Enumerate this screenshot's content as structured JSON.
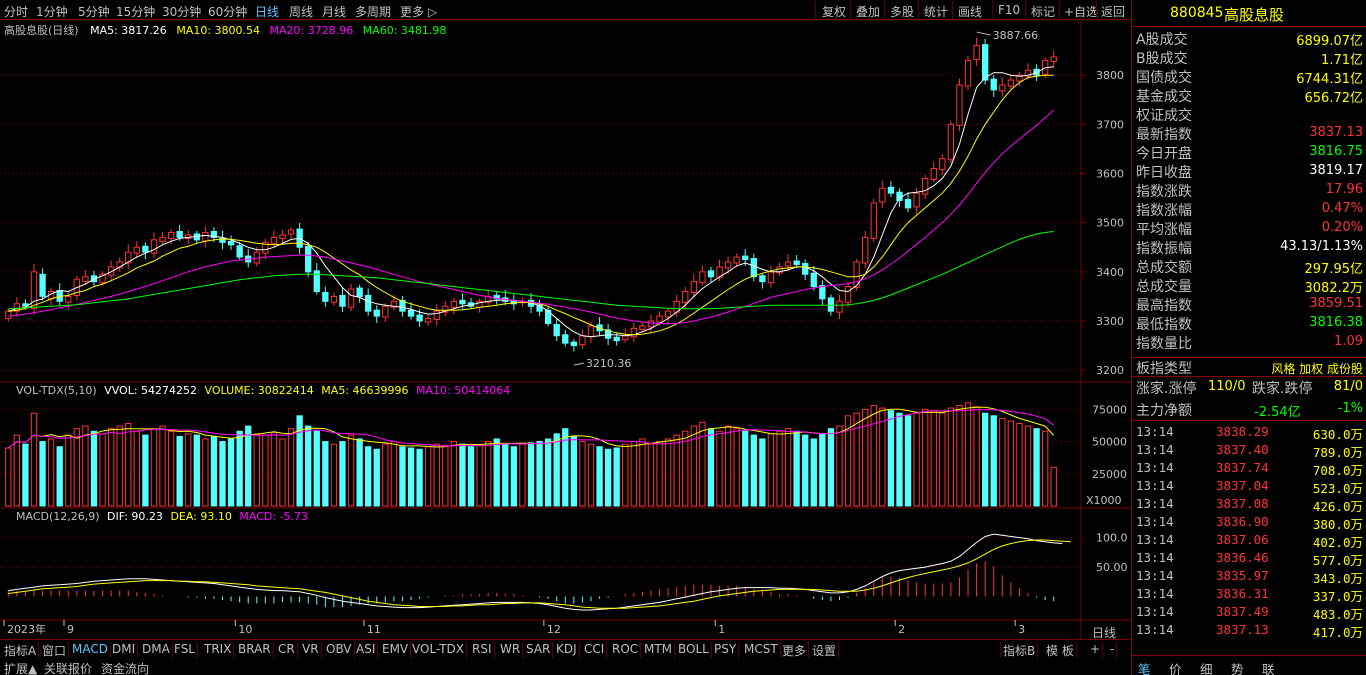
{
  "toolbar": {
    "timeframes": [
      "分时",
      "1分钟",
      "5分钟",
      "15分钟",
      "30分钟",
      "60分钟",
      "日线",
      "周线",
      "月线",
      "多周期",
      "更多 ▷"
    ],
    "active_timeframe": "日线",
    "right_buttons": [
      "复权",
      "叠加",
      "多股",
      "统计",
      "画线",
      "F10",
      "标记",
      "+自选",
      "返回"
    ]
  },
  "main_info": {
    "name": "高股息股(日线)",
    "ma5": "MA5: 3817.26",
    "ma10": "MA10: 3800.54",
    "ma20": "MA20: 3728.96",
    "ma60": "MA60: 3481.98"
  },
  "vol_info": {
    "name": "VOL-TDX(5,10)",
    "vvol": "VVOL: 54274252",
    "volume": "VOLUME: 30822414",
    "ma5": "MA5: 46639996",
    "ma10": "MA10: 50414064"
  },
  "macd_info": {
    "name": "MACD(12,26,9)",
    "dif": "DIF: 90.23",
    "dea": "DEA: 93.10",
    "macd": "MACD: -5.73"
  },
  "colors": {
    "up": "#ff3232",
    "down": "#54ffff",
    "ma5": "#ffffff",
    "ma10": "#ffff00",
    "ma20": "#ff00ff",
    "ma60": "#00ff00",
    "grid": "#7a0000"
  },
  "chart_data": {
    "type": "candlestick",
    "price_axis": {
      "ticks": [
        3200,
        3300,
        3400,
        3500,
        3600,
        3700,
        3800
      ],
      "range": [
        3180,
        3900
      ]
    },
    "volume_axis": {
      "ticks": [
        "25000",
        "50000",
        "75000"
      ],
      "unit": "X1000",
      "range": [
        0,
        90000
      ]
    },
    "macd_axis": {
      "ticks": [
        "50.00",
        "100.0"
      ],
      "range": [
        -40,
        130
      ]
    },
    "high_label": "3887.66",
    "low_label": "3210.36",
    "month_labels": [
      {
        "label": "2023年",
        "index": 0
      },
      {
        "label": "9",
        "index": 7
      },
      {
        "label": "10",
        "index": 27
      },
      {
        "label": "11",
        "index": 42
      },
      {
        "label": "12",
        "index": 63
      },
      {
        "label": "1",
        "index": 83
      },
      {
        "label": "2",
        "index": 104
      },
      {
        "label": "3",
        "index": 118
      }
    ],
    "closes": [
      3320,
      3335,
      3330,
      3400,
      3350,
      3360,
      3340,
      3350,
      3385,
      3390,
      3380,
      3395,
      3410,
      3420,
      3440,
      3450,
      3440,
      3465,
      3470,
      3480,
      3470,
      3475,
      3465,
      3480,
      3470,
      3460,
      3455,
      3430,
      3420,
      3440,
      3460,
      3470,
      3475,
      3485,
      3450,
      3400,
      3360,
      3340,
      3350,
      3330,
      3365,
      3350,
      3320,
      3310,
      3330,
      3340,
      3320,
      3310,
      3300,
      3305,
      3320,
      3330,
      3340,
      3335,
      3330,
      3340,
      3350,
      3345,
      3340,
      3335,
      3340,
      3330,
      3320,
      3295,
      3270,
      3255,
      3250,
      3270,
      3290,
      3280,
      3265,
      3260,
      3270,
      3285,
      3290,
      3300,
      3310,
      3320,
      3340,
      3360,
      3380,
      3400,
      3390,
      3410,
      3420,
      3430,
      3425,
      3390,
      3380,
      3400,
      3410,
      3420,
      3415,
      3395,
      3370,
      3345,
      3320,
      3340,
      3370,
      3420,
      3470,
      3540,
      3570,
      3560,
      3545,
      3530,
      3560,
      3590,
      3610,
      3630,
      3700,
      3780,
      3830,
      3860,
      3790,
      3770,
      3780,
      3790,
      3800,
      3810,
      3800,
      3830,
      3837
    ],
    "opens": [
      3305,
      3320,
      3335,
      3325,
      3395,
      3345,
      3362,
      3338,
      3352,
      3380,
      3392,
      3378,
      3393,
      3408,
      3418,
      3438,
      3452,
      3438,
      3462,
      3468,
      3482,
      3468,
      3477,
      3463,
      3482,
      3468,
      3462,
      3453,
      3432,
      3418,
      3438,
      3458,
      3468,
      3477,
      3487,
      3452,
      3402,
      3358,
      3338,
      3352,
      3328,
      3367,
      3352,
      3322,
      3308,
      3328,
      3342,
      3322,
      3312,
      3298,
      3303,
      3318,
      3328,
      3342,
      3337,
      3328,
      3338,
      3352,
      3347,
      3342,
      3337,
      3342,
      3332,
      3322,
      3293,
      3272,
      3257,
      3252,
      3268,
      3292,
      3282,
      3267,
      3262,
      3268,
      3283,
      3288,
      3298,
      3308,
      3318,
      3338,
      3358,
      3378,
      3402,
      3388,
      3408,
      3418,
      3432,
      3427,
      3392,
      3378,
      3398,
      3412,
      3422,
      3417,
      3397,
      3372,
      3347,
      3318,
      3338,
      3368,
      3418,
      3468,
      3542,
      3572,
      3562,
      3547,
      3532,
      3558,
      3588,
      3608,
      3628,
      3698,
      3778,
      3832,
      3862,
      3792,
      3768,
      3778,
      3788,
      3798,
      3812,
      3802,
      3828
    ],
    "volumes": [
      45,
      55,
      48,
      72,
      50,
      52,
      46,
      55,
      60,
      62,
      58,
      56,
      60,
      62,
      64,
      58,
      55,
      60,
      62,
      58,
      54,
      56,
      55,
      52,
      54,
      50,
      52,
      58,
      62,
      56,
      55,
      57,
      52,
      60,
      70,
      62,
      58,
      50,
      48,
      50,
      55,
      52,
      46,
      44,
      48,
      50,
      46,
      45,
      44,
      46,
      48,
      47,
      50,
      48,
      46,
      47,
      50,
      52,
      48,
      46,
      48,
      49,
      50,
      52,
      56,
      60,
      54,
      50,
      48,
      46,
      44,
      45,
      48,
      50,
      52,
      48,
      50,
      52,
      55,
      58,
      62,
      65,
      60,
      58,
      62,
      60,
      58,
      55,
      52,
      56,
      58,
      60,
      58,
      55,
      52,
      56,
      60,
      62,
      70,
      72,
      75,
      78,
      76,
      74,
      72,
      70,
      72,
      75,
      74,
      72,
      76,
      78,
      80,
      77,
      72,
      70,
      68,
      66,
      64,
      62,
      60,
      58,
      30
    ],
    "ma5": [
      3320,
      3325,
      3328,
      3340,
      3345,
      3355,
      3362,
      3360,
      3368,
      3375,
      3385,
      3392,
      3400,
      3410,
      3420,
      3430,
      3438,
      3445,
      3455,
      3462,
      3468,
      3470,
      3472,
      3474,
      3472,
      3470,
      3465,
      3458,
      3450,
      3445,
      3445,
      3450,
      3458,
      3466,
      3468,
      3458,
      3438,
      3412,
      3390,
      3368,
      3352,
      3348,
      3340,
      3335,
      3332,
      3330,
      3328,
      3324,
      3318,
      3314,
      3315,
      3320,
      3325,
      3330,
      3333,
      3337,
      3340,
      3342,
      3343,
      3342,
      3340,
      3336,
      3332,
      3320,
      3305,
      3290,
      3278,
      3270,
      3268,
      3270,
      3272,
      3272,
      3270,
      3272,
      3278,
      3285,
      3295,
      3305,
      3318,
      3332,
      3350,
      3366,
      3378,
      3390,
      3400,
      3412,
      3418,
      3412,
      3405,
      3400,
      3400,
      3404,
      3410,
      3410,
      3402,
      3390,
      3375,
      3362,
      3360,
      3372,
      3395,
      3430,
      3475,
      3520,
      3550,
      3560,
      3562,
      3565,
      3575,
      3590,
      3615,
      3660,
      3720,
      3775,
      3795,
      3805,
      3805,
      3800,
      3798,
      3800,
      3805,
      3815,
      3817
    ],
    "ma10": [
      3320,
      3322,
      3325,
      3332,
      3338,
      3345,
      3350,
      3352,
      3358,
      3362,
      3370,
      3375,
      3382,
      3390,
      3398,
      3408,
      3415,
      3422,
      3432,
      3440,
      3448,
      3452,
      3458,
      3462,
      3465,
      3467,
      3466,
      3464,
      3461,
      3458,
      3456,
      3455,
      3456,
      3458,
      3458,
      3455,
      3450,
      3440,
      3428,
      3416,
      3404,
      3394,
      3380,
      3368,
      3358,
      3348,
      3340,
      3335,
      3330,
      3325,
      3322,
      3322,
      3322,
      3323,
      3325,
      3328,
      3330,
      3332,
      3335,
      3337,
      3338,
      3337,
      3335,
      3330,
      3322,
      3315,
      3307,
      3300,
      3292,
      3285,
      3280,
      3276,
      3273,
      3272,
      3273,
      3276,
      3280,
      3286,
      3294,
      3304,
      3316,
      3328,
      3340,
      3352,
      3364,
      3375,
      3385,
      3392,
      3397,
      3402,
      3406,
      3408,
      3410,
      3410,
      3408,
      3405,
      3400,
      3395,
      3390,
      3390,
      3395,
      3410,
      3430,
      3455,
      3480,
      3500,
      3515,
      3530,
      3545,
      3560,
      3580,
      3605,
      3635,
      3670,
      3700,
      3725,
      3750,
      3770,
      3785,
      3795,
      3798,
      3800,
      3800
    ],
    "ma20": [
      3310,
      3312,
      3314,
      3317,
      3320,
      3323,
      3327,
      3330,
      3334,
      3338,
      3342,
      3346,
      3350,
      3355,
      3360,
      3365,
      3370,
      3376,
      3382,
      3388,
      3394,
      3400,
      3405,
      3410,
      3414,
      3418,
      3422,
      3424,
      3426,
      3428,
      3430,
      3431,
      3432,
      3433,
      3434,
      3434,
      3432,
      3430,
      3426,
      3422,
      3418,
      3414,
      3410,
      3405,
      3400,
      3395,
      3390,
      3385,
      3380,
      3376,
      3372,
      3368,
      3364,
      3360,
      3356,
      3352,
      3349,
      3346,
      3344,
      3342,
      3340,
      3338,
      3336,
      3334,
      3331,
      3328,
      3325,
      3322,
      3318,
      3314,
      3310,
      3306,
      3303,
      3300,
      3298,
      3296,
      3295,
      3294,
      3295,
      3297,
      3300,
      3304,
      3308,
      3313,
      3318,
      3324,
      3330,
      3336,
      3342,
      3348,
      3352,
      3356,
      3360,
      3364,
      3367,
      3370,
      3372,
      3374,
      3376,
      3380,
      3386,
      3394,
      3404,
      3416,
      3428,
      3442,
      3456,
      3470,
      3485,
      3500,
      3517,
      3536,
      3557,
      3580,
      3602,
      3622,
      3640,
      3656,
      3670,
      3684,
      3698,
      3713,
      3729
    ],
    "ma60": [
      3325,
      3326,
      3327,
      3328,
      3329,
      3330,
      3331,
      3332,
      3333,
      3335,
      3337,
      3339,
      3341,
      3343,
      3345,
      3348,
      3351,
      3354,
      3357,
      3360,
      3363,
      3366,
      3369,
      3372,
      3375,
      3378,
      3381,
      3384,
      3386,
      3388,
      3390,
      3392,
      3393,
      3394,
      3395,
      3395,
      3395,
      3394,
      3393,
      3392,
      3391,
      3390,
      3389,
      3388,
      3386,
      3384,
      3382,
      3380,
      3378,
      3376,
      3374,
      3372,
      3370,
      3368,
      3366,
      3364,
      3362,
      3360,
      3358,
      3356,
      3354,
      3352,
      3350,
      3348,
      3346,
      3344,
      3342,
      3340,
      3338,
      3336,
      3334,
      3332,
      3331,
      3330,
      3329,
      3328,
      3327,
      3326,
      3325,
      3325,
      3325,
      3325,
      3325,
      3326,
      3327,
      3328,
      3329,
      3330,
      3331,
      3332,
      3332,
      3332,
      3332,
      3332,
      3332,
      3332,
      3332,
      3332,
      3333,
      3335,
      3338,
      3342,
      3347,
      3353,
      3360,
      3367,
      3374,
      3381,
      3388,
      3395,
      3403,
      3411,
      3419,
      3427,
      3435,
      3443,
      3451,
      3459,
      3466,
      3472,
      3477,
      3480,
      3482
    ],
    "macd_dif": [
      10,
      12,
      14,
      16,
      18,
      19,
      20,
      21,
      22,
      24,
      26,
      27,
      28,
      29,
      30,
      30,
      30,
      29,
      28,
      27,
      26,
      25,
      24,
      23,
      22,
      20,
      18,
      16,
      14,
      12,
      11,
      10,
      10,
      9,
      8,
      5,
      2,
      -2,
      -5,
      -8,
      -10,
      -12,
      -14,
      -16,
      -17,
      -18,
      -19,
      -19,
      -19,
      -18,
      -17,
      -16,
      -15,
      -14,
      -13,
      -12,
      -11,
      -10,
      -10,
      -10,
      -10,
      -11,
      -12,
      -14,
      -17,
      -20,
      -22,
      -23,
      -23,
      -22,
      -21,
      -20,
      -18,
      -16,
      -14,
      -12,
      -10,
      -7,
      -4,
      -1,
      2,
      5,
      8,
      10,
      12,
      14,
      15,
      15,
      15,
      15,
      14,
      14,
      13,
      12,
      10,
      8,
      6,
      6,
      8,
      12,
      18,
      26,
      34,
      40,
      44,
      46,
      48,
      50,
      53,
      56,
      60,
      68,
      80,
      92,
      102,
      106,
      104,
      102,
      100,
      98,
      95,
      93,
      91,
      90
    ],
    "macd_dea": [
      5,
      7,
      9,
      11,
      13,
      14,
      15,
      16,
      17,
      19,
      21,
      22,
      23,
      24,
      25,
      26,
      27,
      27,
      27,
      27,
      26,
      26,
      25,
      25,
      24,
      23,
      22,
      21,
      20,
      18,
      17,
      16,
      15,
      14,
      13,
      11,
      9,
      7,
      4,
      1,
      -2,
      -5,
      -8,
      -10,
      -12,
      -14,
      -15,
      -16,
      -17,
      -17,
      -17,
      -17,
      -16,
      -16,
      -15,
      -14,
      -14,
      -13,
      -12,
      -12,
      -11,
      -11,
      -11,
      -12,
      -13,
      -14,
      -16,
      -18,
      -19,
      -20,
      -20,
      -20,
      -20,
      -19,
      -18,
      -17,
      -16,
      -14,
      -12,
      -10,
      -8,
      -5,
      -2,
      1,
      3,
      5,
      7,
      9,
      10,
      11,
      12,
      12,
      12,
      12,
      12,
      11,
      10,
      9,
      9,
      9,
      11,
      14,
      18,
      23,
      28,
      32,
      36,
      39,
      42,
      45,
      48,
      52,
      57,
      64,
      72,
      80,
      86,
      90,
      93,
      95,
      96,
      96,
      95,
      94,
      93
    ]
  },
  "right_panel": {
    "code": "880845",
    "name": "高股息股",
    "stats": [
      {
        "label": "A股成交",
        "value": "6899.07亿",
        "color": "#ffff00"
      },
      {
        "label": "B股成交",
        "value": "1.71亿",
        "color": "#ffff00"
      },
      {
        "label": "国债成交",
        "value": "6744.31亿",
        "color": "#ffff00"
      },
      {
        "label": "基金成交",
        "value": "656.72亿",
        "color": "#ffff00"
      },
      {
        "label": "权证成交",
        "value": "",
        "color": "#ffff00"
      },
      {
        "label": "最新指数",
        "value": "3837.13",
        "color": "#ff3232"
      },
      {
        "label": "今日开盘",
        "value": "3816.75",
        "color": "#00ff00"
      },
      {
        "label": "昨日收盘",
        "value": "3819.17",
        "color": "#ffffff"
      },
      {
        "label": "指数涨跌",
        "value": "17.96",
        "color": "#ff3232"
      },
      {
        "label": "指数涨幅",
        "value": "0.47%",
        "color": "#ff3232"
      },
      {
        "label": "平均涨幅",
        "value": "0.20%",
        "color": "#ff3232"
      },
      {
        "label": "指数振幅",
        "value": "43.13/1.13%",
        "color": "#ffffff"
      },
      {
        "label": "总成交额",
        "value": "297.95亿",
        "color": "#ffff00"
      },
      {
        "label": "总成交量",
        "value": "3082.2万",
        "color": "#ffff00"
      },
      {
        "label": "最高指数",
        "value": "3859.51",
        "color": "#ff3232"
      },
      {
        "label": "最低指数",
        "value": "3816.38",
        "color": "#00ff00"
      },
      {
        "label": "指数量比",
        "value": "1.09",
        "color": "#ff3232"
      }
    ],
    "board_label": "板指类型",
    "board_value": "风格 加权 成份股",
    "breadth": {
      "up_label": "涨家.涨停",
      "up_value": "110/0",
      "down_label": "跌家.跌停",
      "down_value": "81/0"
    },
    "mainflow": {
      "label": "主力净额",
      "value": "-2.54亿",
      "pct": "-1%"
    },
    "ticks": [
      {
        "time": "13:14",
        "price": "3838.29",
        "vol": "630.0万"
      },
      {
        "time": "13:14",
        "price": "3837.40",
        "vol": "789.0万"
      },
      {
        "time": "13:14",
        "price": "3837.74",
        "vol": "708.0万"
      },
      {
        "time": "13:14",
        "price": "3837.04",
        "vol": "523.0万"
      },
      {
        "time": "13:14",
        "price": "3837.08",
        "vol": "426.0万"
      },
      {
        "time": "13:14",
        "price": "3836.90",
        "vol": "380.0万"
      },
      {
        "time": "13:14",
        "price": "3837.06",
        "vol": "402.0万"
      },
      {
        "time": "13:14",
        "price": "3836.46",
        "vol": "577.0万"
      },
      {
        "time": "13:14",
        "price": "3835.97",
        "vol": "343.0万"
      },
      {
        "time": "13:14",
        "price": "3836.31",
        "vol": "337.0万"
      },
      {
        "time": "13:14",
        "price": "3837.49",
        "vol": "483.0万"
      },
      {
        "time": "13:14",
        "price": "3837.13",
        "vol": "417.0万"
      }
    ],
    "bottom_tabs": [
      "笔",
      "价",
      "细",
      "势",
      "联"
    ]
  },
  "bottom": {
    "tabs": [
      "指标A",
      "窗口",
      "MACD",
      "DMI",
      "DMA",
      "FSL",
      "TRIX",
      "BRAR",
      "CR",
      "VR",
      "OBV",
      "ASI",
      "EMV",
      "VOL-TDX",
      "RSI",
      "WR",
      "SAR",
      "KDJ",
      "CCI",
      "ROC",
      "MTM",
      "BOLL",
      "PSY",
      "MCST",
      "更多",
      "设置"
    ],
    "active_tab": "MACD",
    "right_tabs": [
      "指标B",
      "模 板",
      "+",
      "-"
    ],
    "period_label": "日线",
    "second_row": [
      "扩展▲",
      "关联报价",
      "资金流向"
    ]
  }
}
